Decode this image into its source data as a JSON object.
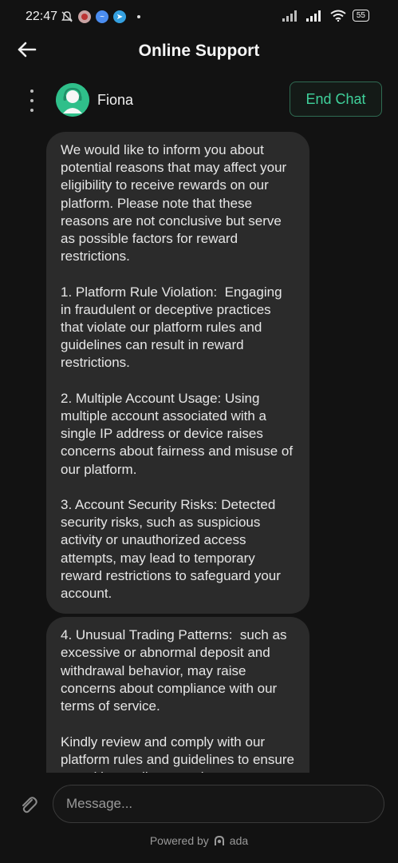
{
  "status_bar": {
    "time": "22:47",
    "battery": "55",
    "icons": [
      "mute-bell-icon",
      "app-icon-red",
      "messenger-icon",
      "telegram-icon",
      "dot-icon",
      "signal-icon",
      "signal-icon",
      "wifi-icon",
      "battery-icon"
    ]
  },
  "header": {
    "title": "Online Support",
    "back_icon": "back-arrow-icon"
  },
  "agent": {
    "name": "Fiona",
    "end_chat_label": "End Chat",
    "menu_icon": "kebab-menu-icon",
    "accent": "#3fd19b"
  },
  "messages": [
    {
      "text": "We would like to inform you about potential reasons that may affect your eligibility to receive rewards on our platform. Please note that these reasons are not conclusive but serve as possible factors for reward restrictions.\n\n1. Platform Rule Violation:  Engaging in fraudulent or deceptive practices that violate our platform rules and guidelines can result in reward restrictions.\n\n2. Multiple Account Usage: Using multiple account associated with a single IP address or device raises concerns about fairness and misuse of our platform.\n\n3. Account Security Risks: Detected security risks, such as suspicious activity or unauthorized access attempts, may lead to temporary reward restrictions to safeguard your account."
    },
    {
      "text": "4. Unusual Trading Patterns:  such as excessive or abnormal deposit and withdrawal behavior, may raise concerns about compliance with our terms of service.\n\nKindly review and comply with our platform rules and guidelines to ensure a positive trading experience."
    }
  ],
  "composer": {
    "placeholder": "Message...",
    "attach_icon": "paperclip-icon"
  },
  "footer": {
    "powered_by": "Powered by",
    "brand": "ada"
  }
}
